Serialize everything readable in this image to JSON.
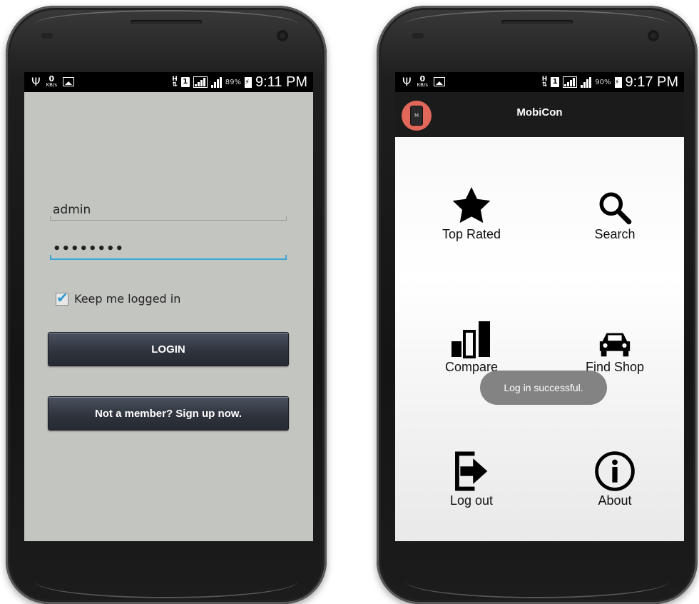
{
  "left_phone": {
    "status_bar": {
      "net_speed_value": "0",
      "net_speed_unit": "KB/s",
      "network_type": "H",
      "sim_slot": "1",
      "battery_percent": "89%",
      "time": "9:11 PM"
    },
    "login": {
      "username_value": "admin",
      "password_value": "••••••••",
      "remember_label": "Keep me logged in",
      "remember_checked": true,
      "login_label": "LOGIN",
      "signup_label": "Not a member? Sign up now."
    }
  },
  "right_phone": {
    "status_bar": {
      "net_speed_value": "0",
      "net_speed_unit": "KB/s",
      "network_type": "H",
      "sim_slot": "1",
      "battery_percent": "90%",
      "time": "9:17 PM"
    },
    "actionbar": {
      "title": "MobiCon",
      "logo_icon": "phone-logo-icon",
      "logo_color": "#e0675a"
    },
    "menu": {
      "top_rated": {
        "label": "Top Rated",
        "icon": "star-icon"
      },
      "search": {
        "label": "Search",
        "icon": "magnifier-icon"
      },
      "compare": {
        "label": "Compare",
        "icon": "bar-chart-icon"
      },
      "find_shop": {
        "label": "Find Shop",
        "icon": "car-icon"
      },
      "logout": {
        "label": "Log out",
        "icon": "exit-icon"
      },
      "about": {
        "label": "About",
        "icon": "info-icon"
      }
    },
    "toast": "Log in successful."
  },
  "colors": {
    "login_bg": "#c3c5c0",
    "focus_underline": "#3ba4d6",
    "checkbox_check": "#2f9bd2",
    "button_dark": "#2f343d"
  }
}
